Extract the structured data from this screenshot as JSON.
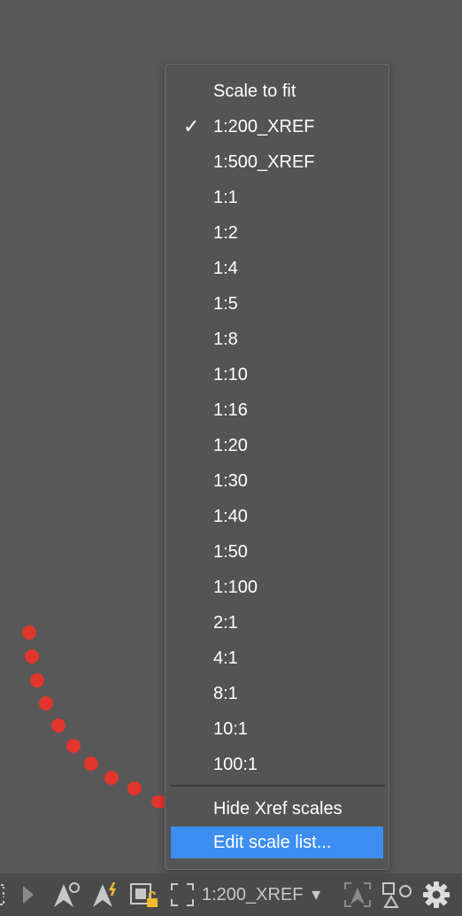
{
  "menu": {
    "items": [
      {
        "label": "Scale to fit",
        "checked": false
      },
      {
        "label": "1:200_XREF",
        "checked": true
      },
      {
        "label": "1:500_XREF",
        "checked": false
      },
      {
        "label": "1:1",
        "checked": false
      },
      {
        "label": "1:2",
        "checked": false
      },
      {
        "label": "1:4",
        "checked": false
      },
      {
        "label": "1:5",
        "checked": false
      },
      {
        "label": "1:8",
        "checked": false
      },
      {
        "label": "1:10",
        "checked": false
      },
      {
        "label": "1:16",
        "checked": false
      },
      {
        "label": "1:20",
        "checked": false
      },
      {
        "label": "1:30",
        "checked": false
      },
      {
        "label": "1:40",
        "checked": false
      },
      {
        "label": "1:50",
        "checked": false
      },
      {
        "label": "1:100",
        "checked": false
      },
      {
        "label": "2:1",
        "checked": false
      },
      {
        "label": "4:1",
        "checked": false
      },
      {
        "label": "8:1",
        "checked": false
      },
      {
        "label": "10:1",
        "checked": false
      },
      {
        "label": "100:1",
        "checked": false
      }
    ],
    "check_glyph": "✓",
    "hide_xref": "Hide Xref scales",
    "edit_list": "Edit scale list...",
    "highlight_color": "#3d8ef0"
  },
  "statusbar": {
    "current_scale": "1:200_XREF",
    "dropdown_glyph": "▾",
    "icons": [
      "model-space-icon",
      "play-icon",
      "annotation-visibility-icon",
      "auto-scale-icon",
      "lock-viewport-icon",
      "fit-viewport-icon",
      "scale-dropdown",
      "annotation-monitor-icon",
      "isolate-objects-icon",
      "settings-gear-icon"
    ]
  },
  "annotation_color": "#e0362c"
}
